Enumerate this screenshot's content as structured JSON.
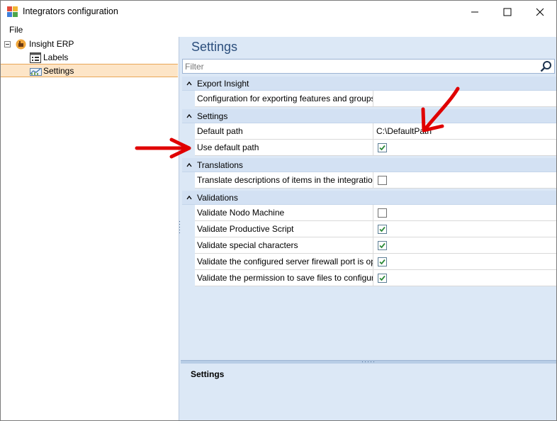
{
  "window": {
    "title": "Integrators configuration",
    "minimize_glyph": "—",
    "maximize_glyph": "☐",
    "close_glyph": "✕"
  },
  "menu": {
    "file": "File"
  },
  "tree": {
    "root": {
      "label": "Insight ERP",
      "icon": "factory-icon"
    },
    "items": [
      {
        "label": "Labels",
        "icon": "labels-icon"
      },
      {
        "label": "Settings",
        "icon": "settings-chart-icon",
        "selected": true
      }
    ]
  },
  "panel": {
    "heading": "Settings",
    "filter_placeholder": "Filter",
    "help_title": "Settings"
  },
  "categories": [
    {
      "label": "Export Insight",
      "rows": [
        {
          "name": "Configuration for exporting features and groups...",
          "value": ""
        }
      ]
    },
    {
      "label": "Settings",
      "rows": [
        {
          "name": "Default path",
          "value": "C:\\DefaultPath"
        },
        {
          "name": "Use default path",
          "checked": true
        }
      ]
    },
    {
      "label": "Translations",
      "rows": [
        {
          "name": "Translate descriptions of items in the integration",
          "checked": false
        }
      ]
    },
    {
      "label": "Validations",
      "rows": [
        {
          "name": "Validate Nodo Machine",
          "checked": false
        },
        {
          "name": "Validate Productive Script",
          "checked": true
        },
        {
          "name": "Validate special characters",
          "checked": true
        },
        {
          "name": "Validate the configured server firewall port is op...",
          "checked": true
        },
        {
          "name": "Validate the permission to save files to configure...",
          "checked": true
        }
      ]
    }
  ],
  "colors": {
    "accent": "#2b4e7c",
    "annotation_arrow": "#e00000",
    "selection": "#fde5c7"
  }
}
